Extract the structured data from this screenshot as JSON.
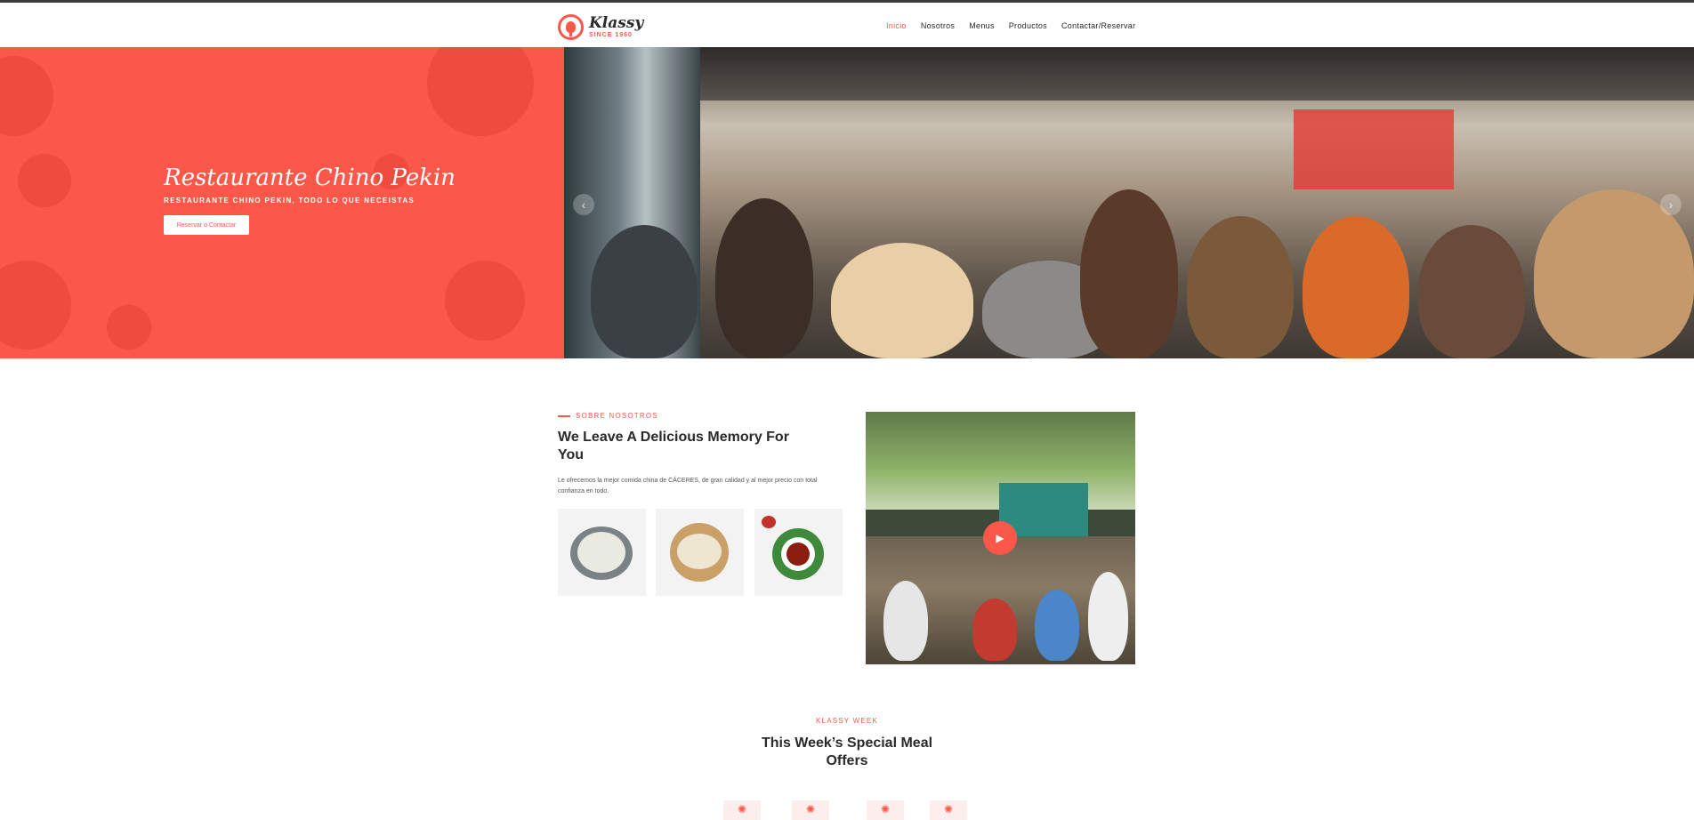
{
  "brand": {
    "name": "Klassy",
    "since": "SINCE 1960",
    "accent": "#fb5849"
  },
  "nav": {
    "items": [
      {
        "label": "Inicio",
        "active": true
      },
      {
        "label": "Nosotros",
        "active": false
      },
      {
        "label": "Menus",
        "active": false
      },
      {
        "label": "Productos",
        "active": false
      },
      {
        "label": "Contactar/Reservar",
        "active": false
      }
    ]
  },
  "hero": {
    "title": "Restaurante Chino Pekin",
    "subtitle": "RESTAURANTE CHINO PEKIN, TODO LO QUE NECEISTAS",
    "button": "Reservar o Contactar",
    "prev_icon": "chevron-left-icon",
    "next_icon": "chevron-right-icon"
  },
  "about": {
    "tag": "SOBRE NOSOTROS",
    "title": "We Leave A Delicious Memory For You",
    "text": "Le ofrecemos la mejor comida china de CÁCERES, de gran calidad y al mejor precio con total confianza en todo.",
    "play_icon": "play-icon"
  },
  "week": {
    "tag": "KLASSY WEEK",
    "title": "This Week’s Special Meal Offers"
  }
}
